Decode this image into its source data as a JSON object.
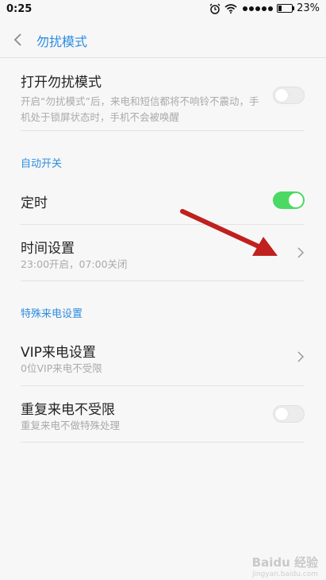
{
  "status_bar": {
    "time": "0:25",
    "battery_percent": "23%",
    "battery_level": 0.23,
    "icons": [
      "alarm-icon",
      "wifi-icon",
      "signal-dots-icon",
      "battery-icon"
    ]
  },
  "header": {
    "title": "勿扰模式",
    "back_icon": "chevron-left-icon"
  },
  "main_toggle": {
    "title": "打开勿扰模式",
    "description": "开启“勿扰模式”后，来电和短信都将不响铃不震动，手机处于锁屏状态时，手机不会被唤醒",
    "enabled": false
  },
  "sections": {
    "auto": "自动开关",
    "special": "特殊来电设置"
  },
  "schedule": {
    "title": "定时",
    "enabled": true
  },
  "time_setting": {
    "title": "时间设置",
    "subtitle": "23:00开启，07:00关闭"
  },
  "vip": {
    "title": "VIP来电设置",
    "subtitle": "0位VIP来电不受限"
  },
  "repeat": {
    "title": "重复来电不受限",
    "subtitle": "重复来电不做特殊处理",
    "enabled": false
  },
  "colors": {
    "accent": "#2c8de0",
    "switch_on": "#4cd963",
    "annotation_arrow": "#c0201e"
  },
  "watermark": {
    "text": "Baidu 经验",
    "sub": "jingyan.baidu.com"
  }
}
